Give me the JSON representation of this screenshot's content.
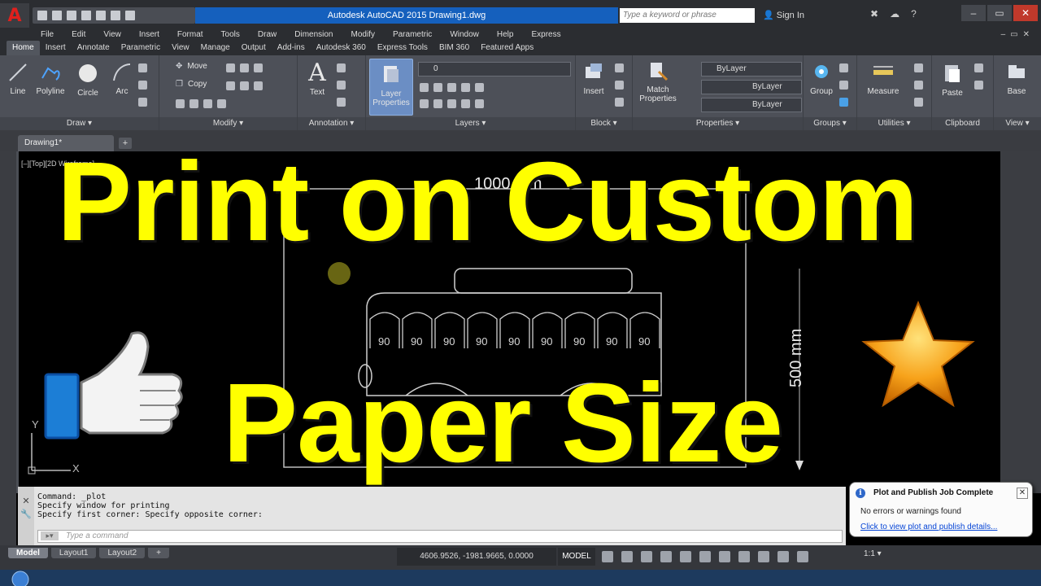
{
  "titlebar": {
    "app_logo": "A",
    "title": "Autodesk AutoCAD 2015    Drawing1.dwg",
    "search_placeholder": "Type a keyword or phrase",
    "sign_in": "Sign In",
    "minimize": "–",
    "restore": "▭",
    "close": "✕"
  },
  "menubar": {
    "items": [
      "File",
      "Edit",
      "View",
      "Insert",
      "Format",
      "Tools",
      "Draw",
      "Dimension",
      "Modify",
      "Parametric",
      "Window",
      "Help",
      "Express"
    ]
  },
  "ribbon_tabs": {
    "items": [
      "Home",
      "Insert",
      "Annotate",
      "Parametric",
      "View",
      "Manage",
      "Output",
      "Add-ins",
      "Autodesk 360",
      "Express Tools",
      "BIM 360",
      "Featured Apps"
    ]
  },
  "ribbon": {
    "draw": {
      "title": "Draw ▾",
      "line": "Line",
      "polyline": "Polyline",
      "circle": "Circle",
      "arc": "Arc"
    },
    "modify": {
      "title": "Modify ▾",
      "move": "Move",
      "copy": "Copy"
    },
    "annotation": {
      "title": "Annotation ▾",
      "text": "Text"
    },
    "layers": {
      "title": "Layers ▾",
      "layer_properties_1": "Layer",
      "layer_properties_2": "Properties",
      "current_layer": "0"
    },
    "block": {
      "title": "Block ▾",
      "insert": "Insert"
    },
    "properties": {
      "title": "Properties ▾",
      "match_1": "Match",
      "match_2": "Properties",
      "color": "ByLayer",
      "linetype": "ByLayer",
      "lineweight": "ByLayer"
    },
    "groups": {
      "title": "Groups ▾",
      "group": "Group"
    },
    "utilities": {
      "title": "Utilities ▾",
      "measure": "Measure"
    },
    "clipboard": {
      "title": "Clipboard",
      "paste": "Paste"
    },
    "view": {
      "title": "View ▾",
      "base": "Base"
    }
  },
  "file_tabs": {
    "drawing": "Drawing1*",
    "plus": "+"
  },
  "viewport_label": "[–][Top][2D Wireframe]",
  "drawing": {
    "dim_horizontal": "1000 mm",
    "dim_vertical": "500 mm",
    "seat_label": "90",
    "seat_count": 9
  },
  "headline": {
    "line1": "Print on Custom",
    "line2": "Paper Size"
  },
  "command": {
    "history": [
      "Command: _plot",
      "Specify window for printing",
      "Specify first corner: Specify opposite corner:"
    ],
    "input_placeholder": "Type a command"
  },
  "status": {
    "layout_tabs": [
      "Model",
      "Layout1",
      "Layout2",
      "+"
    ],
    "coords": "4606.9526, -1981.9665, 0.0000",
    "model_label": "MODEL",
    "scale": "1:1 ▾"
  },
  "notification": {
    "title": "Plot and Publish Job Complete",
    "message": "No errors or warnings found",
    "link": "Click to view plot and publish details..."
  },
  "colors": {
    "headline": "#ffff00",
    "accent_blue": "#1560bd",
    "app_red": "#e0201d",
    "star": "#f7a21a",
    "thumb_blue": "#1c7ed6"
  },
  "icons": {
    "thumbs_up": "thumbs-up-icon",
    "star": "star-icon",
    "ucs": "ucs-icon"
  }
}
